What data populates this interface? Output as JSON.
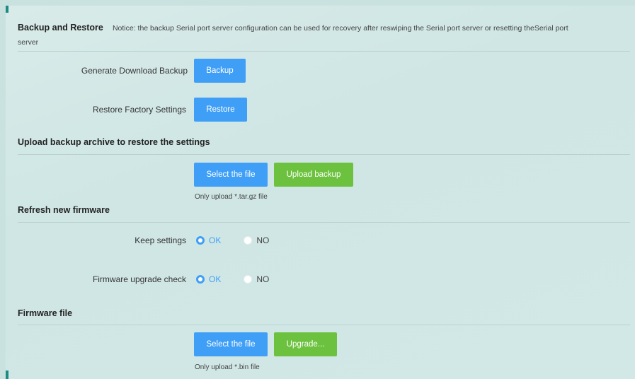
{
  "header": {
    "title": "Backup and Restore",
    "notice_line1": "Notice: the backup Serial port server configuration can be used for recovery after reswiping the Serial port server or resetting theSerial port",
    "notice_line2": "server"
  },
  "backup": {
    "generate_label": "Generate Download Backup",
    "backup_button": "Backup",
    "restore_label": "Restore Factory Settings",
    "restore_button": "Restore"
  },
  "upload": {
    "title": "Upload backup archive to restore the settings",
    "select_button": "Select the file",
    "upload_button": "Upload backup",
    "hint": "Only upload *.tar.gz file"
  },
  "firmware": {
    "title": "Refresh new firmware",
    "keep_settings_label": "Keep settings",
    "keep_settings_ok": "OK",
    "keep_settings_no": "NO",
    "keep_settings_selected": "OK",
    "upgrade_check_label": "Firmware upgrade check",
    "upgrade_check_ok": "OK",
    "upgrade_check_no": "NO",
    "upgrade_check_selected": "OK"
  },
  "firmware_file": {
    "title": "Firmware file",
    "select_button": "Select the file",
    "upgrade_button": "Upgrade...",
    "hint": "Only upload *.bin file"
  },
  "colors": {
    "primary_blue": "#3f9ff7",
    "primary_green": "#6cc23e",
    "accent_teal": "#1e8a84"
  }
}
